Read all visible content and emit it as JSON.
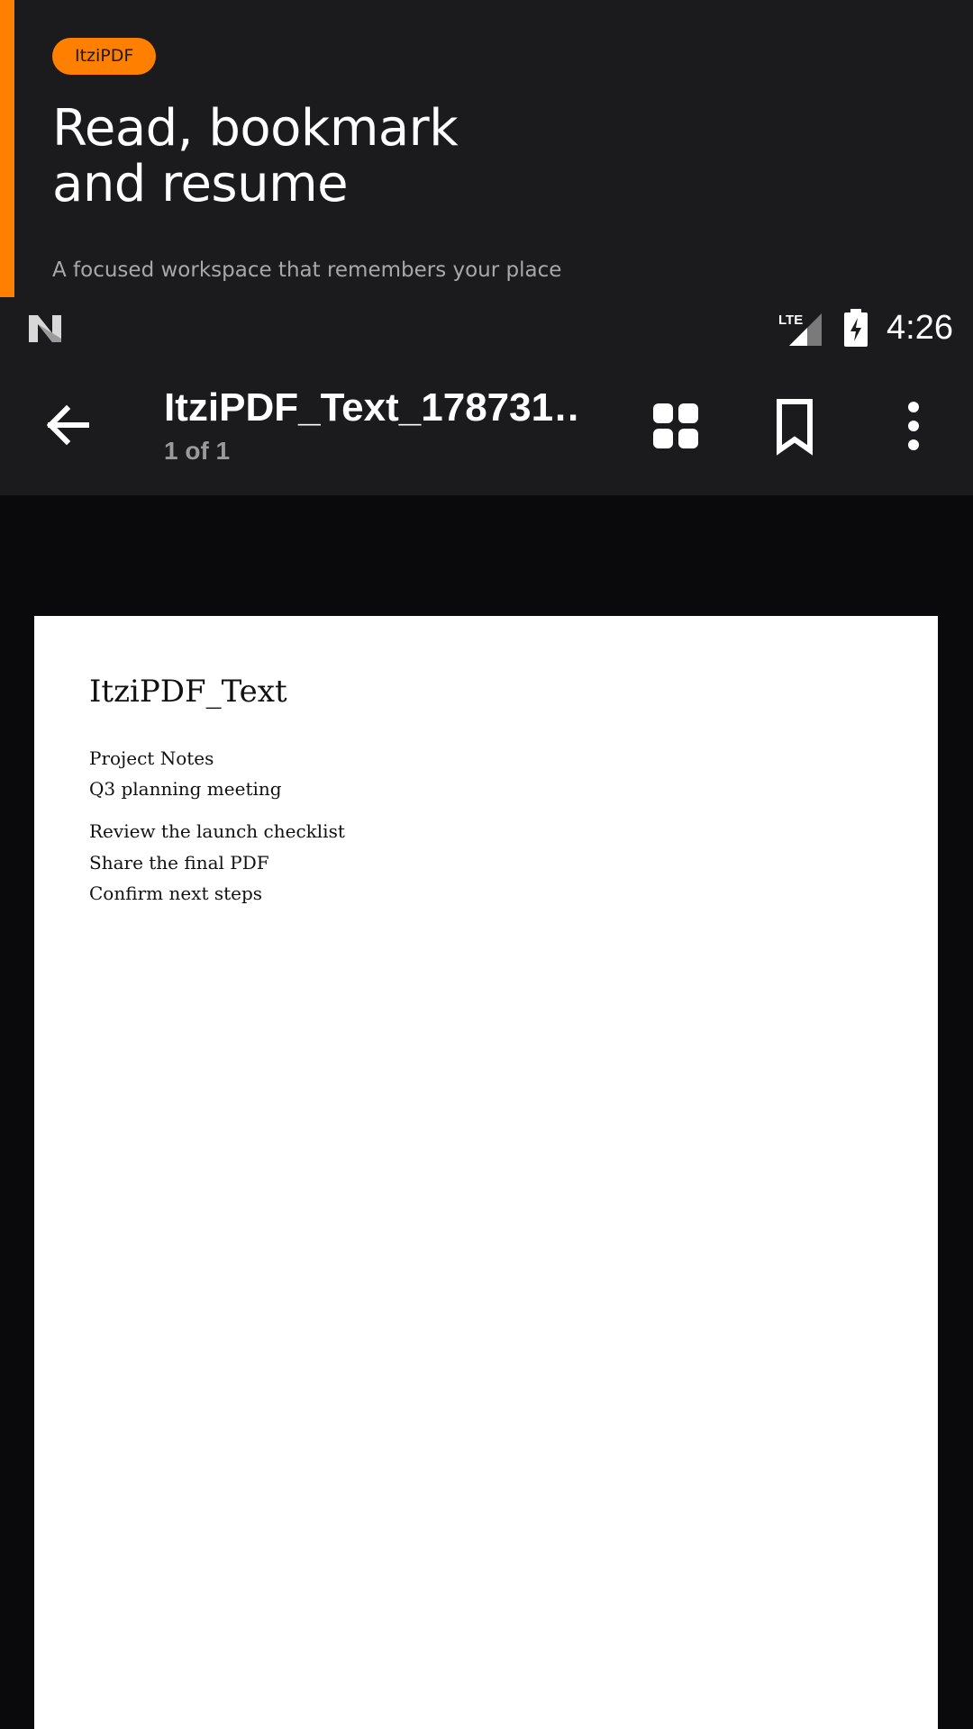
{
  "promo": {
    "brand": "ItziPDF",
    "headline_line1": "Read, bookmark",
    "headline_line2": "and resume",
    "subline": "A focused workspace that remembers your place",
    "accent_color": "#ff7f00"
  },
  "statusbar": {
    "network": "LTE",
    "time": "4:26",
    "icons": [
      "n-logo-icon",
      "lte-signal-icon",
      "battery-charging-icon"
    ]
  },
  "toolbar": {
    "title": "ItziPDF_Text_178731…",
    "page_count": "1 of 1",
    "icons": [
      "back-arrow-icon",
      "grid-view-icon",
      "bookmark-icon",
      "more-vert-icon"
    ]
  },
  "document": {
    "title": "ItziPDF_Text",
    "lines": [
      "Project Notes",
      "Q3 planning meeting",
      "Review the launch checklist",
      "Share the final PDF",
      "Confirm next steps"
    ]
  }
}
